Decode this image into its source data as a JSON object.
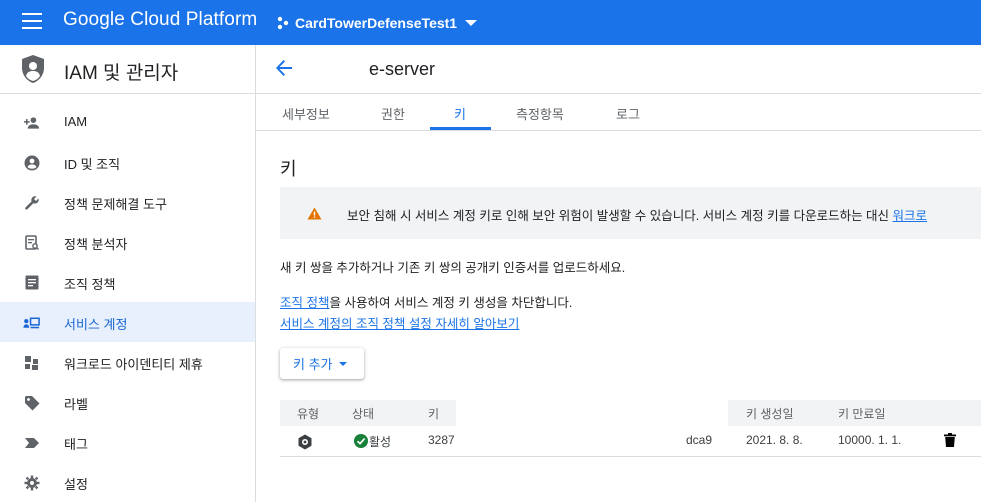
{
  "topbar": {
    "product_name": "Google Cloud Platform",
    "project_name": "CardTowerDefenseTest1"
  },
  "sidebar": {
    "title": "IAM 및 관리자",
    "items": [
      {
        "label": "IAM",
        "icon": "person-add-icon"
      },
      {
        "label": "ID 및 조직",
        "icon": "account-circle-icon"
      },
      {
        "label": "정책 문제해결 도구",
        "icon": "wrench-icon"
      },
      {
        "label": "정책 분석자",
        "icon": "document-search-icon"
      },
      {
        "label": "조직 정책",
        "icon": "list-doc-icon"
      },
      {
        "label": "서비스 계정",
        "icon": "service-account-icon",
        "active": true
      },
      {
        "label": "워크로드 아이덴티티 제휴",
        "icon": "workload-icon"
      },
      {
        "label": "라벨",
        "icon": "label-icon"
      },
      {
        "label": "태그",
        "icon": "tag-icon"
      },
      {
        "label": "설정",
        "icon": "gear-icon"
      }
    ]
  },
  "page": {
    "title": "e-server",
    "tabs": [
      "세부정보",
      "권한",
      "키",
      "측정항목",
      "로그"
    ],
    "active_tab": "키",
    "section_title": "키",
    "warning_text": "보안 침해 시 서비스 계정 키로 인해 보안 위험이 발생할 수 있습니다. 서비스 계정 키를 다운로드하는 대신 ",
    "warning_link": "워크로",
    "description": "새 키 쌍을 추가하거나 기존 키 쌍의 공개키 인증서를 업로드하세요.",
    "policy_link": "조직 정책",
    "policy_text": "을 사용하여 서비스 계정 키 생성을 차단합니다.",
    "learn_more": "서비스 계정의 조직 정책 설정 자세히 알아보기",
    "add_key_label": "키 추가"
  },
  "table": {
    "headers": [
      "유형",
      "상태",
      "키",
      "키 생성일",
      "키 만료일"
    ],
    "rows": [
      {
        "type_icon": "key-type-icon",
        "status": "활성",
        "key_start": "3287",
        "key_end": "dca9",
        "created": "2021. 8. 8.",
        "expires": "10000. 1. 1."
      }
    ]
  },
  "colors": {
    "brand": "#1a73e8",
    "active_bg": "#e8f0fe",
    "warning": "#e37400",
    "success": "#188038"
  }
}
